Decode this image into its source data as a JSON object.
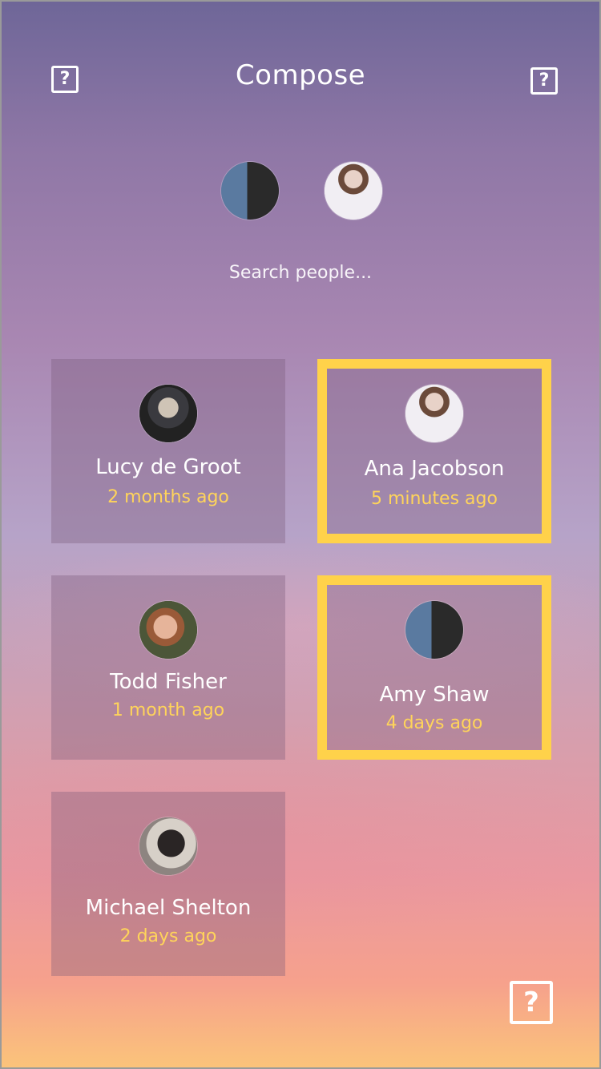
{
  "header": {
    "title": "Compose",
    "left_icon": "help-icon",
    "right_icon": "help-icon"
  },
  "selected_people": [
    {
      "avatar": "avatar-amy-shaw"
    },
    {
      "avatar": "avatar-ana-jacobson"
    }
  ],
  "search": {
    "placeholder": "Search people..."
  },
  "people": [
    {
      "name": "Lucy de Groot",
      "time": "2 months ago",
      "selected": false
    },
    {
      "name": "Ana Jacobson",
      "time": "5 minutes ago",
      "selected": true
    },
    {
      "name": "Todd Fisher",
      "time": "1 month ago",
      "selected": false
    },
    {
      "name": "Amy Shaw",
      "time": "4 days ago",
      "selected": true
    },
    {
      "name": "Michael Shelton",
      "time": "2 days ago",
      "selected": false
    }
  ],
  "footer": {
    "help_icon": "help-icon"
  },
  "colors": {
    "accent": "#ffd24a",
    "time_text": "#ffd45a"
  }
}
